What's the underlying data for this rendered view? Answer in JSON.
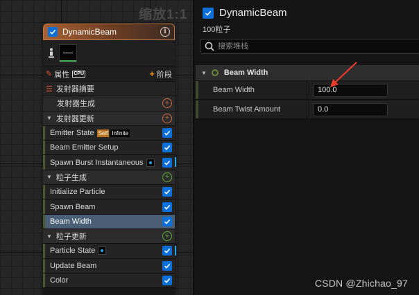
{
  "graph": {
    "zoom_label": "缩放1:1",
    "node": {
      "title": "DynamicBeam",
      "properties_label": "属性",
      "cpu_badge": "CPU",
      "stage_label": "阶段",
      "rows": [
        {
          "kind": "summary",
          "label": "发射器摘要"
        },
        {
          "kind": "plain",
          "label": "发射器生成",
          "action": "orange"
        },
        {
          "kind": "section",
          "label": "发射器更新",
          "action": "orange"
        },
        {
          "kind": "module",
          "label": "Emitter State",
          "tags": [
            "Self",
            "Infinite"
          ],
          "checked": true
        },
        {
          "kind": "module",
          "label": "Beam Emitter Setup",
          "checked": true
        },
        {
          "kind": "module",
          "label": "Spawn Burst Instantaneous",
          "dot": true,
          "checked": true,
          "edge": true
        },
        {
          "kind": "section",
          "label": "粒子生成",
          "action": "green"
        },
        {
          "kind": "module",
          "label": "Initialize Particle",
          "checked": true
        },
        {
          "kind": "module",
          "label": "Spawn Beam",
          "checked": true
        },
        {
          "kind": "module",
          "label": "Beam Width",
          "checked": true,
          "selected": true
        },
        {
          "kind": "section",
          "label": "粒子更新",
          "action": "green"
        },
        {
          "kind": "module",
          "label": "Particle State",
          "dot": true,
          "checked": true,
          "edge": true
        },
        {
          "kind": "module",
          "label": "Update Beam",
          "checked": true
        },
        {
          "kind": "module",
          "label": "Color",
          "checked": true
        }
      ]
    }
  },
  "details": {
    "title": "DynamicBeam",
    "subtitle": "100粒子",
    "search_placeholder": "搜索堆栈",
    "category": "Beam Width",
    "properties": [
      {
        "name": "Beam Width",
        "value": "100.0"
      },
      {
        "name": "Beam Twist Amount",
        "value": "0.0"
      }
    ]
  },
  "colors": {
    "accent_blue": "#0e6fd8",
    "header_orange": "#a86133",
    "selected_row": "#4a5f75",
    "arrow_red": "#e53a2c"
  },
  "watermark": "CSDN @Zhichao_97"
}
